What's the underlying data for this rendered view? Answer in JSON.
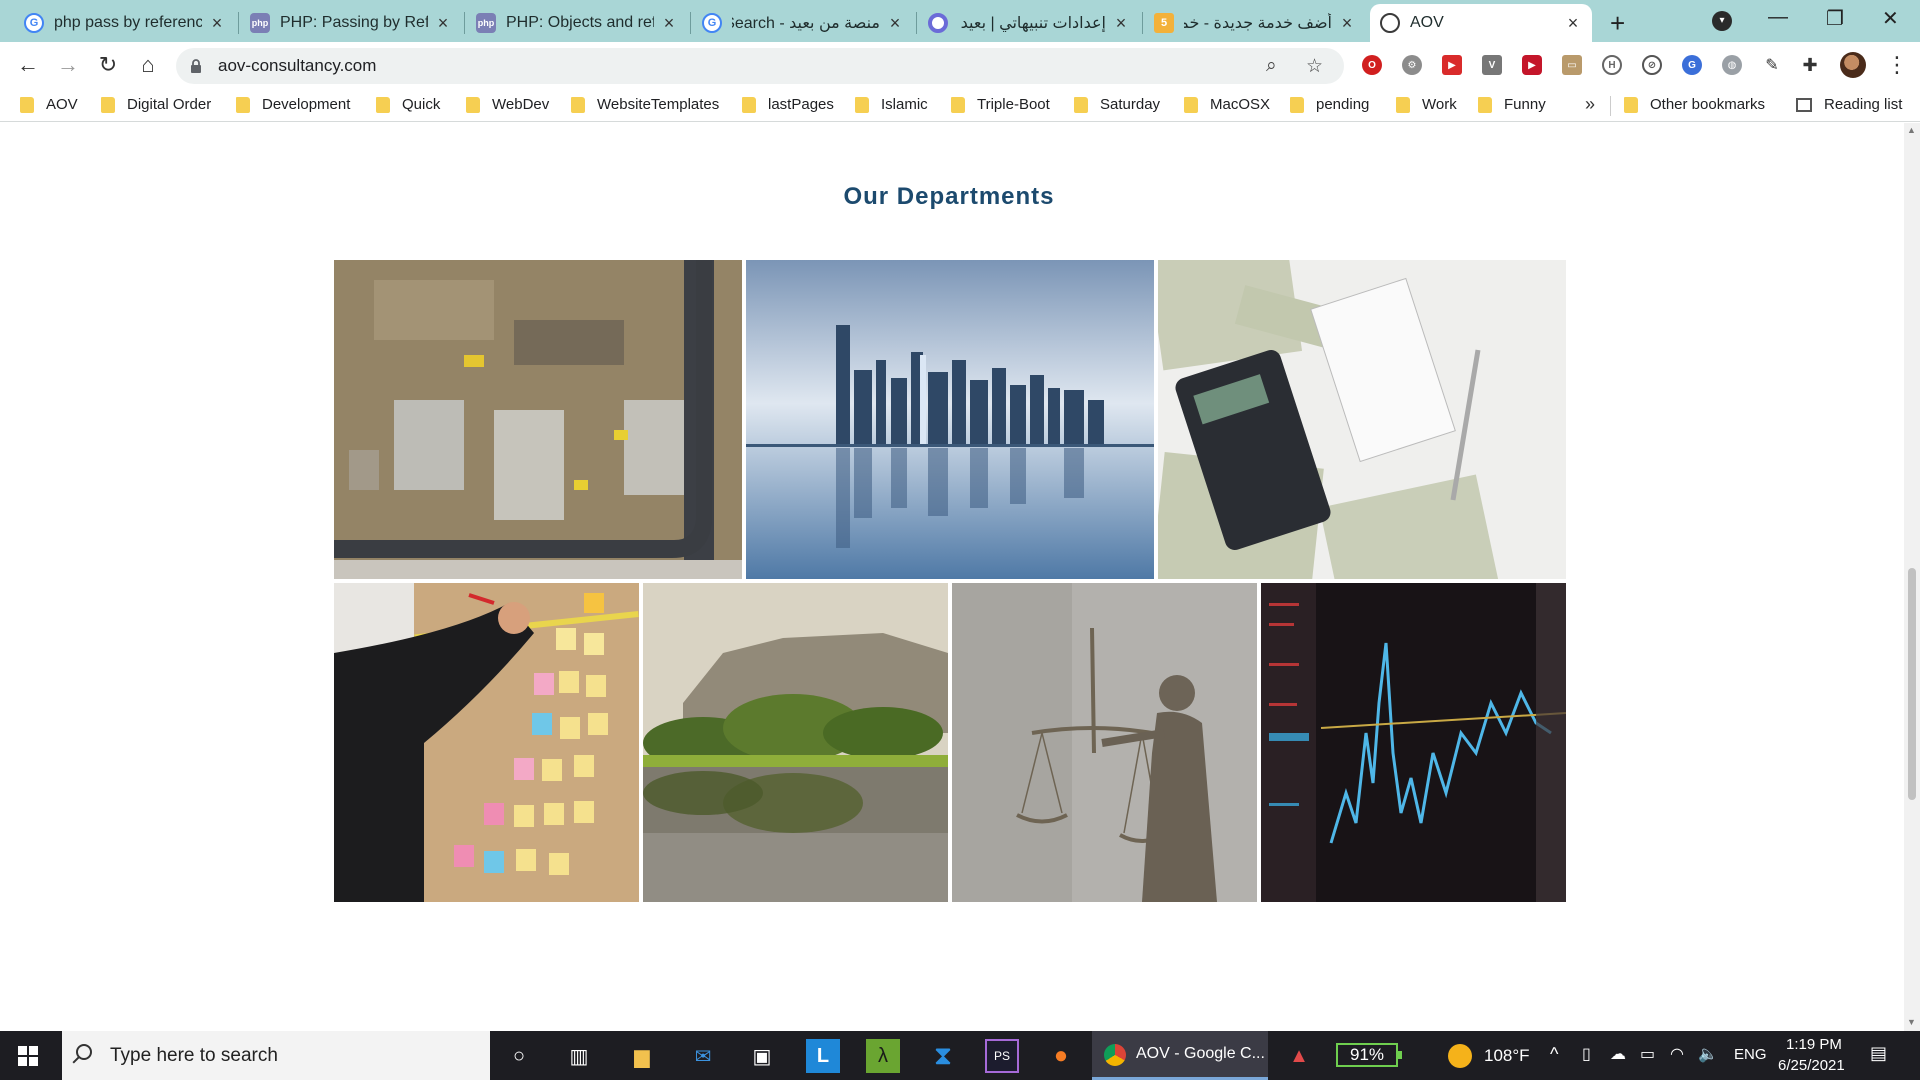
{
  "browser": {
    "tabs": [
      {
        "title": "php pass by reference",
        "favicon": "google-icon",
        "active": false
      },
      {
        "title": "PHP: Passing by Refere",
        "favicon": "php-icon",
        "active": false
      },
      {
        "title": "PHP: Objects and refe",
        "favicon": "php-icon",
        "active": false
      },
      {
        "title": "منصة من بعيد - Search",
        "favicon": "google-icon",
        "active": false
      },
      {
        "title": "إعدادات تنبيهاتي | بعيد",
        "favicon": "ring-icon",
        "active": false
      },
      {
        "title": "أضف خدمة جديدة - خم",
        "favicon": "five-icon",
        "active": false
      },
      {
        "title": "AOV",
        "favicon": "globe-icon",
        "active": true
      }
    ],
    "new_tab_symbol": "+",
    "url": "aov-consultancy.com",
    "bookmarks": [
      "AOV",
      "Digital Order",
      "Development",
      "Quick",
      "WebDev",
      "WebsiteTemplates",
      "lastPages",
      "Islamic",
      "Triple-Boot",
      "Saturday",
      "MacOSX",
      "pending",
      "Work",
      "Funny"
    ],
    "bookmarks_more": "»",
    "other_bookmarks": "Other bookmarks",
    "reading_list": "Reading list"
  },
  "page": {
    "section_title": "Our Departments",
    "departments_top": [
      {
        "image": "construction-site-aerial"
      },
      {
        "image": "city-skyline-reflection"
      },
      {
        "image": "calculator-money-notepad"
      }
    ],
    "departments_bottom": [
      {
        "image": "sticky-notes-board"
      },
      {
        "image": "lake-trees-mountain"
      },
      {
        "image": "justice-statue-scales"
      },
      {
        "image": "stock-chart-screen"
      }
    ]
  },
  "taskbar": {
    "search_placeholder": "Type here to search",
    "active_app_label": "AOV - Google C...",
    "battery": "91%",
    "weather": "108°F",
    "language": "ENG",
    "time": "1:19 PM",
    "date": "6/25/2021"
  }
}
